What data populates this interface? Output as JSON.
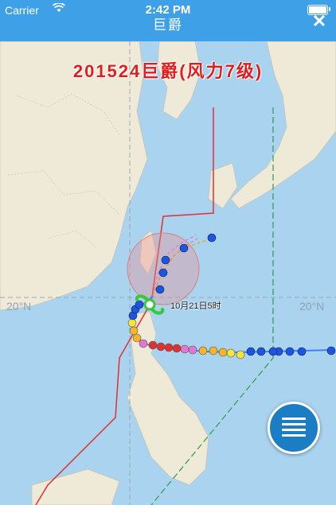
{
  "status_bar": {
    "carrier": "Carrier",
    "time": "2:42 PM"
  },
  "header": {
    "title": "巨爵",
    "close_icon": "close-icon"
  },
  "map": {
    "storm_label": "201524巨爵(风力7级)",
    "lat_label_left": "20°N",
    "lat_label_right": "20°N",
    "track_time_label": "10月21日5时",
    "colors": {
      "warning_line_24h": "#e03131",
      "warning_line_48h": "#2f9e44",
      "track": "#3b82f6",
      "wind_circle": "#f28b8b"
    }
  },
  "legend_button": {
    "icon": "list-icon"
  }
}
